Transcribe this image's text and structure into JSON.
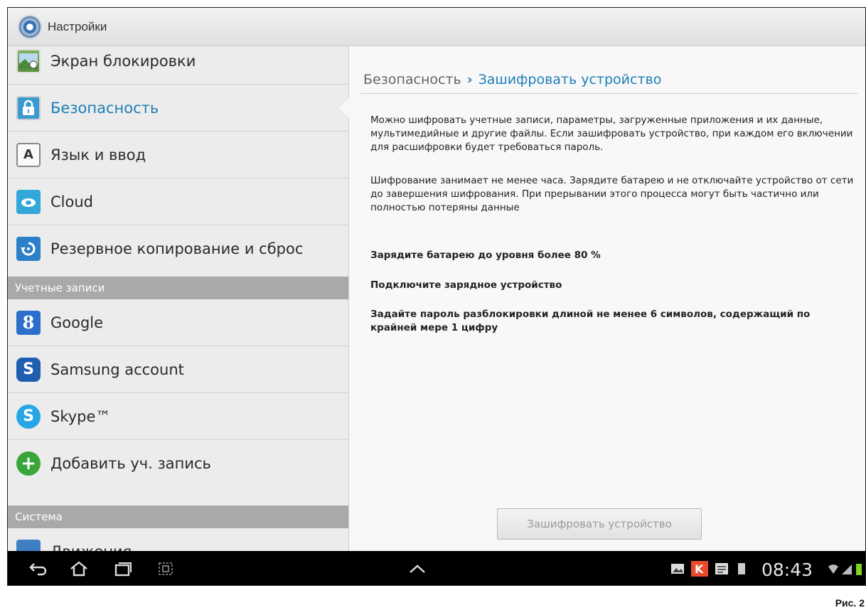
{
  "app": {
    "title": "Настройки"
  },
  "sidebar": {
    "items": [
      {
        "label": "Экран блокировки"
      },
      {
        "label": "Безопасность"
      },
      {
        "label": "Язык и ввод"
      },
      {
        "label": "Cloud"
      },
      {
        "label": "Резервное копирование и сброс"
      }
    ],
    "section_accounts": "Учетные записи",
    "accounts": [
      {
        "label": "Google"
      },
      {
        "label": "Samsung account"
      },
      {
        "label": "Skype™"
      },
      {
        "label": "Добавить уч. запись"
      }
    ],
    "section_system": "Система",
    "system": [
      {
        "label": "Движения"
      }
    ]
  },
  "main": {
    "breadcrumb_parent": "Безопасность",
    "breadcrumb_sep": "›",
    "breadcrumb_current": "Зашифровать устройство",
    "para1": "Можно шифровать учетные записи, параметры, загруженные приложения и их данные, мультимедийные и другие файлы. Если зашифровать устройство, при каждом его включении для расшифровки будет требоваться пароль.",
    "para2": "Шифрование занимает не менее часа. Зарядите батарею и не отключайте устройство от сети до завершения шифрования. При прерывании этого процесса могут быть частично или полностью потеряны данные",
    "req1": "Зарядите батарею до уровня более 80 %",
    "req2": "Подключите зарядное устройство",
    "req3": "Задайте пароль разблокировки длиной не менее 6 символов, содержащий по крайней мере 1 цифру",
    "button": "Зашифровать устройство"
  },
  "statusbar": {
    "time": "08:43"
  },
  "caption": "Рис. 2",
  "colors": {
    "accent": "#1d7fb8",
    "section": "#a9a9a9",
    "sysbar": "#000000"
  },
  "icons": [
    "settings-icon",
    "lock-screen-icon",
    "security-lock-icon",
    "language-icon",
    "cloud-icon",
    "backup-icon",
    "google-icon",
    "samsung-icon",
    "skype-icon",
    "add-account-icon",
    "motion-icon",
    "back-icon",
    "home-icon",
    "recent-apps-icon",
    "screenshot-icon",
    "up-arrow-icon",
    "gallery-icon",
    "kaspersky-icon",
    "notes-icon",
    "sd-icon",
    "wifi-icon",
    "signal-icon",
    "battery-icon"
  ]
}
